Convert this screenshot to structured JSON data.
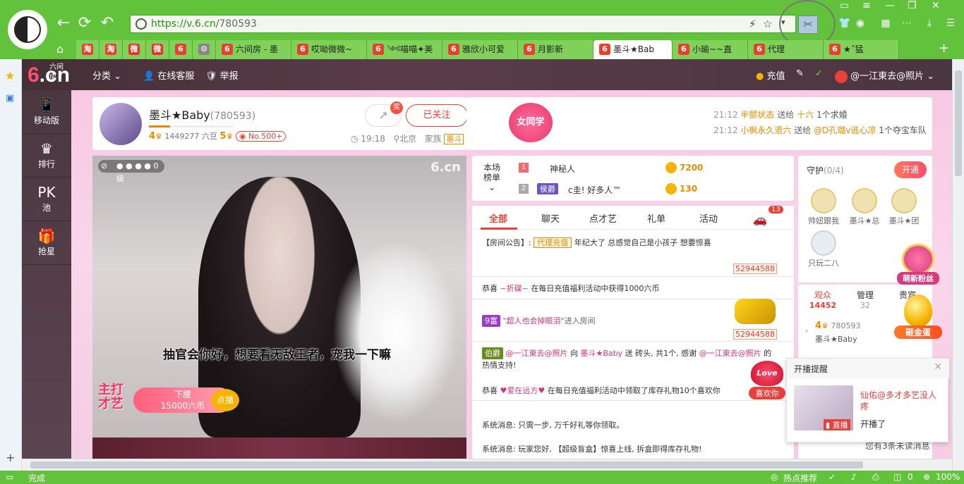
{
  "browser": {
    "url_host": "https://v.6.cn/",
    "url_path": "780593",
    "tabs": [
      {
        "label": "",
        "fav": "淘",
        "color": "#e8412b",
        "w": 33
      },
      {
        "label": "",
        "fav": "淘",
        "color": "#e8412b",
        "w": 33
      },
      {
        "label": "",
        "fav": "微",
        "color": "#e6332a",
        "w": 33
      },
      {
        "label": "",
        "fav": "微",
        "color": "#e6332a",
        "w": 33
      },
      {
        "label": "",
        "fav": "6",
        "color": "#e8412b",
        "w": 33
      },
      {
        "label": "",
        "fav": "⚙",
        "color": "#888888",
        "w": 33
      },
      {
        "label": "六间房 - 墨",
        "fav": "6",
        "color": "#e8412b",
        "w": 107
      },
      {
        "label": "哎呦微微~",
        "fav": "6",
        "color": "#e8412b",
        "w": 107
      },
      {
        "label": "༺喵喵✦美",
        "fav": "6",
        "color": "#e8412b",
        "w": 107
      },
      {
        "label": "雅欣小可爱",
        "fav": "6",
        "color": "#e8412b",
        "w": 107
      },
      {
        "label": "月影新",
        "fav": "6",
        "color": "#e8412b",
        "w": 107
      },
      {
        "label": "墨斗★Bab",
        "fav": "6",
        "color": "#e8412b",
        "w": 112,
        "active": true
      },
      {
        "label": "小瑜~~直",
        "fav": "6",
        "color": "#e8412b",
        "w": 107
      },
      {
        "label": "代理",
        "fav": "6",
        "color": "#e8412b",
        "w": 107
      },
      {
        "label": "★ˇ猛",
        "fav": "6",
        "color": "#e8412b",
        "w": 107
      }
    ],
    "status_left": "完成",
    "status_hot": "热点推荐",
    "status_zero": "0",
    "status_zoom": "100%"
  },
  "site": {
    "logo_small": "六间房",
    "logo": "cn",
    "nav_category": "分类",
    "nav_service": "在线客服",
    "nav_report": "举报",
    "recharge": "充值",
    "user": "@一江東去@照片"
  },
  "leftnav": [
    {
      "icon": "📱",
      "label": "移动版"
    },
    {
      "icon": "♛",
      "label": "排行"
    },
    {
      "icon": "PK",
      "label": "池"
    },
    {
      "icon": "🎁",
      "label": "抢星"
    }
  ],
  "anchor": {
    "name": "墨斗★Baby",
    "rid": "(780593)",
    "level_a": "4",
    "beans": "1449277 六豆",
    "level_b": "5",
    "rank": "No.500+",
    "share_badge": "奖",
    "follow": "已关注",
    "time": "19:18",
    "city": "北京",
    "family_label": "家族",
    "family": "墨斗",
    "girl_badge": "女同学"
  },
  "notices": [
    {
      "time": "21:12",
      "text": "半颤状态",
      "mid": "送给",
      "to": "十六",
      "gift": "1个求婚"
    },
    {
      "time": "21:12",
      "text": "小枫永久退六",
      "mid": "送给",
      "to": "@D孔璐v逃心凉",
      "gift": "1个夺宝车队"
    }
  ],
  "video": {
    "level": "0级",
    "caption": "抽官会你好，想要看无敌王者，宠我一下嘛",
    "logo": "6.cn",
    "dance_l1": "主打",
    "dance_l2": "才艺",
    "req_title": "下腰",
    "req_price": "15000六币",
    "req_btn": "点播"
  },
  "rank": {
    "label_1": "本场",
    "label_2": "榜单",
    "rows": [
      {
        "no": "1",
        "name": "神秘人",
        "coins": "7200"
      },
      {
        "no": "2",
        "name": "c圭! 好多人™",
        "badge": "侯爵",
        "coins": "130"
      }
    ]
  },
  "chat": {
    "tabs": [
      "全部",
      "聊天",
      "点才艺",
      "礼单",
      "活动"
    ],
    "car_count": "13",
    "notice_prefix": "【房间公告】:",
    "notice_tag": "代理充值",
    "notice_text": "年纪大了 总感觉自己是小孩子 想要惊喜",
    "chip1": "52944588",
    "congrats1_pre": "恭喜",
    "congrats1_name": "~折碟~",
    "congrats1_text": "在每日充值福利活动中获得1000六币",
    "enter_tag": "9富",
    "enter_name": "\"超人也会掉眼泪\"",
    "enter_text": "进入房间",
    "chip2": "52944588",
    "gift_tag": "伯爵",
    "gift_from": "@一江東去@照片",
    "gift_mid": "向",
    "gift_to": "墨斗★Baby",
    "gift_send": "送",
    "gift_item": "砖头, 共1个, 感谢",
    "gift_from2": "@一江東去@照片",
    "gift_thanks": "的热情支持!",
    "congrats2_pre": "恭喜",
    "congrats2_name": "♥爱在远方♥",
    "congrats2_text": "在每日充值福利活动中领取了库存礼物10个喜欢你",
    "sys1": "系统消息: 只需一步, 万千好礼等你领取。",
    "sys2": "系统消息: 玩家您好, 【超级盲盒】惊喜上线, 拆盒即得库存礼物!"
  },
  "guard": {
    "title": "守护",
    "count": "(0/4)",
    "open": "开通",
    "members": [
      "帅妞跟我",
      "墨斗★总",
      "墨斗★团",
      "只玩二八"
    ]
  },
  "audience": {
    "tabs": [
      {
        "label": "观众",
        "num": "14452"
      },
      {
        "label": "管理",
        "num": "32"
      },
      {
        "label": "贵宾",
        "num": ""
      }
    ],
    "item_level": "4",
    "item_id": "780593",
    "item_name": "墨斗★Baby",
    "unread": "您有3条未读消息"
  },
  "badges": {
    "fans": "萌新粉丝",
    "egg": "砸金蛋",
    "love": "喜欢你",
    "love_word": "Love"
  },
  "popup": {
    "title": "开播提醒",
    "name": "仙佑@多才多艺没人疼",
    "status": "开播了",
    "live": "直播"
  }
}
